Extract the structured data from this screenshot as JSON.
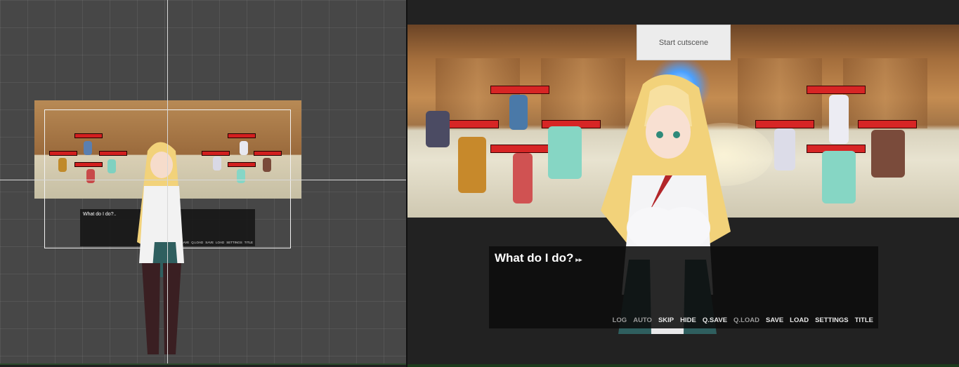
{
  "scene_view": {
    "dialog_text": "What do I do?..",
    "menu": [
      "LOG",
      "AUTO",
      "SKIP",
      "HIDE",
      "Q.SAVE",
      "Q.LOAD",
      "SAVE",
      "LOAD",
      "SETTINGS",
      "TITLE"
    ]
  },
  "game_view": {
    "cutscene_button": "Start cutscene",
    "dialog_text": "What do I do?",
    "advance_icon": "▸▸",
    "menu": {
      "log": "LOG",
      "auto": "AUTO",
      "skip": "SKIP",
      "hide": "HIDE",
      "qsave": "Q.SAVE",
      "qload": "Q.LOAD",
      "save": "SAVE",
      "load": "LOAD",
      "settings": "SETTINGS",
      "title": "TITLE"
    }
  },
  "colors": {
    "hp_bar": "#d72525",
    "dialog_bg": "#0c0c0c",
    "editor_bg": "#474747"
  }
}
